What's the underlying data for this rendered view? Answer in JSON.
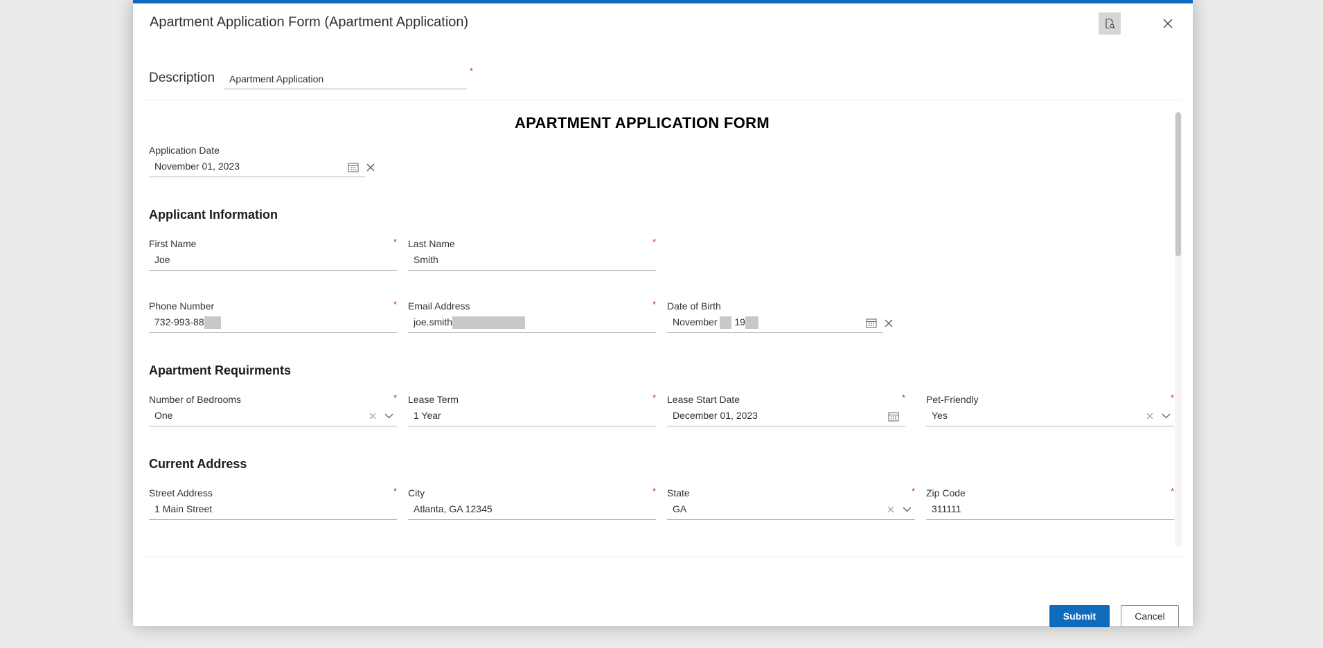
{
  "dialog": {
    "title": "Apartment Application Form (Apartment Application)",
    "description_label": "Description",
    "description_value": "Apartment Application",
    "required_mark": "*"
  },
  "form": {
    "title": "APARTMENT APPLICATION FORM",
    "application_date": {
      "label": "Application Date",
      "value": "November 01, 2023"
    },
    "sections": {
      "applicant": "Applicant Information",
      "apartment": "Apartment Requirments",
      "address": "Current Address"
    },
    "first_name": {
      "label": "First Name",
      "value": "Joe"
    },
    "last_name": {
      "label": "Last Name",
      "value": "Smith"
    },
    "phone": {
      "label": "Phone Number",
      "value": "732-993-88"
    },
    "email": {
      "label": "Email Address",
      "value": "joe.smith"
    },
    "dob": {
      "label": "Date of Birth",
      "value_month": "November",
      "value_year": "19"
    },
    "bedrooms": {
      "label": "Number of Bedrooms",
      "value": "One"
    },
    "lease_term": {
      "label": "Lease Term",
      "value": "1 Year"
    },
    "lease_start": {
      "label": "Lease Start Date",
      "value": "December 01, 2023"
    },
    "pet_friendly": {
      "label": "Pet-Friendly",
      "value": "Yes"
    },
    "street": {
      "label": "Street Address",
      "value": "1 Main Street"
    },
    "city": {
      "label": "City",
      "value": "Atlanta, GA 12345"
    },
    "state": {
      "label": "State",
      "value": "GA"
    },
    "zip": {
      "label": "Zip Code",
      "value": "311111"
    }
  },
  "footer": {
    "submit_label": "Submit",
    "cancel_label": "Cancel"
  },
  "colors": {
    "accent": "#0f6cbd",
    "required": "#c4314b",
    "backdrop": "#ebebeb"
  },
  "icons": [
    "popout-icon",
    "close-icon",
    "calendar-icon",
    "clear-icon",
    "chevron-down-icon"
  ]
}
